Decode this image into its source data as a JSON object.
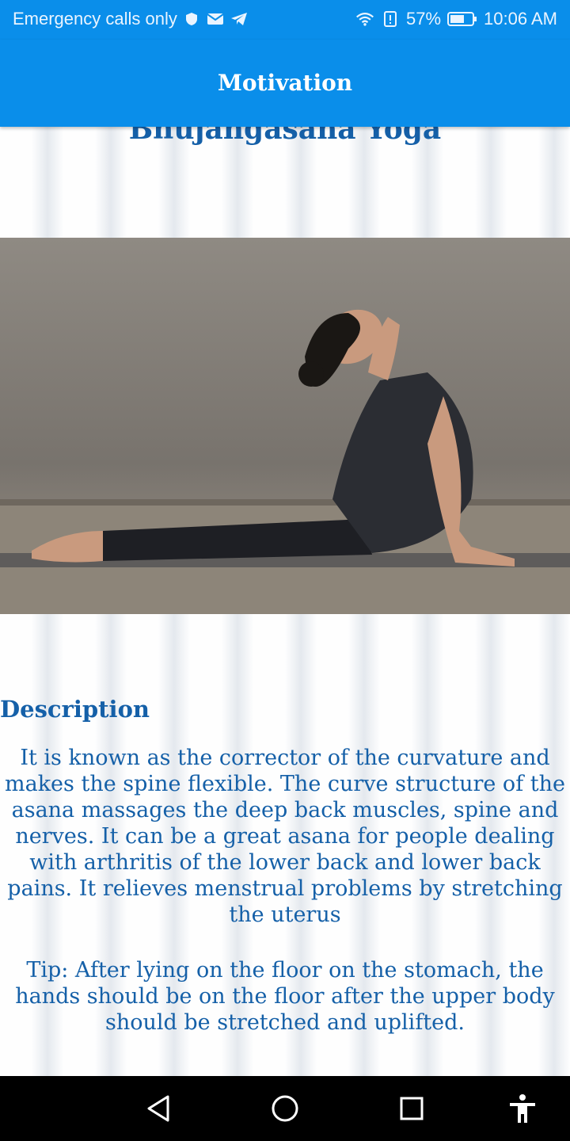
{
  "status_bar": {
    "carrier": "Emergency calls only",
    "battery": "57%",
    "time": "10:06 AM",
    "icons": [
      "shield-icon",
      "mail-icon",
      "telegram-icon",
      "wifi-icon",
      "battery-icon"
    ]
  },
  "app_bar": {
    "title": "Motivation"
  },
  "pose": {
    "title": "Bhujangasana Yoga",
    "image_alt": "woman-in-cobra-pose"
  },
  "description": {
    "heading": "Description",
    "text": "It is known as the corrector of the curvature and makes the spine flexible. The curve structure of the asana massages the deep back muscles, spine and nerves. It can be a great asana for people dealing with arthritis of the lower back and lower back pains. It relieves menstrual problems by stretching the uterus",
    "tip": "Tip: After lying on the floor on the stomach, the hands should be on the floor after the upper body should be stretched and uplifted."
  },
  "nav_bar": {
    "icons": [
      "back-icon",
      "home-icon",
      "recents-icon",
      "accessibility-icon"
    ]
  },
  "colors": {
    "primary": "#0a8eea",
    "text": "#1560a8"
  }
}
